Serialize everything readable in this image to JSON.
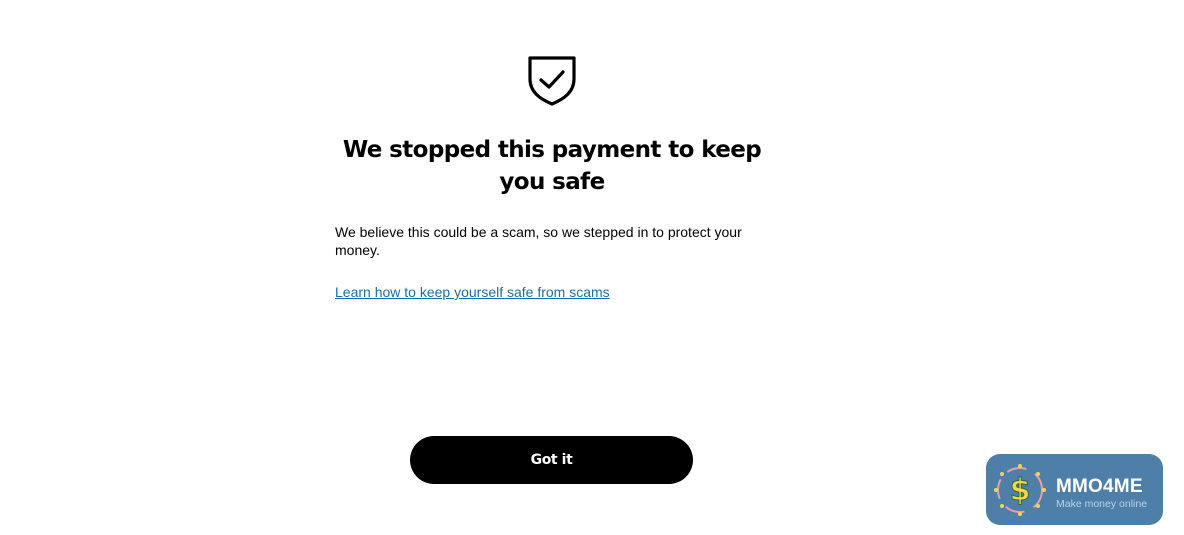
{
  "dialog": {
    "icon": "shield-check-icon",
    "title": "We stopped this payment to keep you safe",
    "message": "We believe this could be a scam, so we stepped in to protect your money.",
    "link_label": "Learn how to keep yourself safe from scams",
    "primary_button_label": "Got it"
  },
  "watermark": {
    "name": "MMO4ME",
    "tagline": "Make money online",
    "logo_icon": "dollar-sign-icon"
  },
  "colors": {
    "background": "#ffffff",
    "text": "#000000",
    "link": "#1a6fa8",
    "button": "#000000",
    "button_text": "#ffffff",
    "watermark_bg": "#4d7fa8"
  }
}
